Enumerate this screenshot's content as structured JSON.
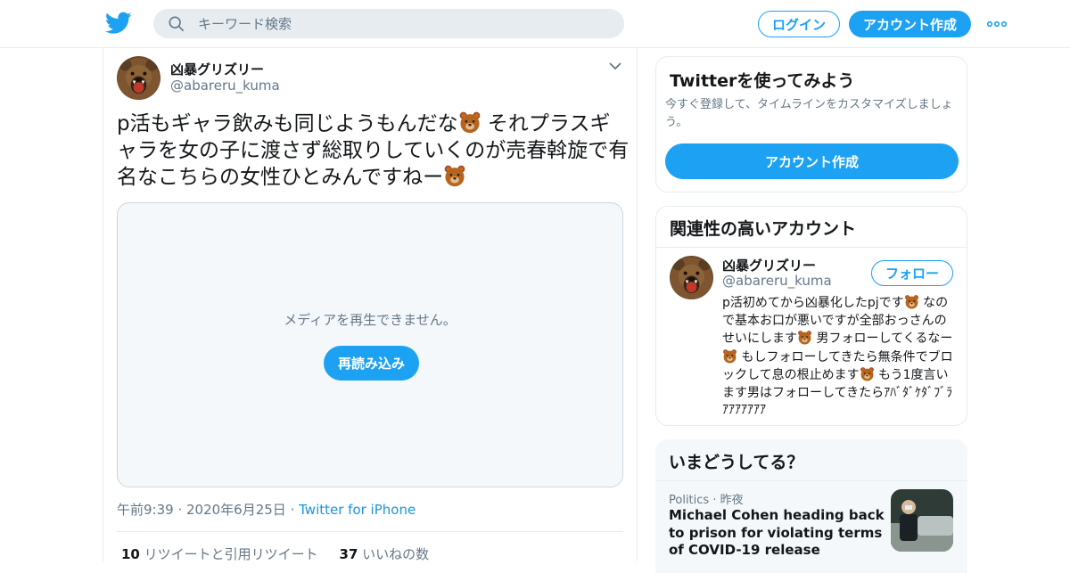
{
  "header": {
    "search_placeholder": "キーワード検索",
    "login_label": "ログイン",
    "signup_label": "アカウント作成"
  },
  "tweet": {
    "display_name": "凶暴グリズリー",
    "handle": "@abareru_kuma",
    "text_part1": "p活もギャラ飲みも同じようもんだな",
    "text_part2": " それプラスギャラを女の子に渡さず総取りしていくのが売春斡旋で有名なこちらの女性ひとみんですねー",
    "media_message": "メディアを再生できません。",
    "reload_label": "再読み込み",
    "time": "午前9:39",
    "date": "2020年6月25日",
    "source": "Twitter for iPhone",
    "retweets_count": "10",
    "retweets_label": "リツイートと引用リツイート",
    "likes_count": "37",
    "likes_label": "いいねの数"
  },
  "signup_card": {
    "title": "Twitterを使ってみよう",
    "description": "今すぐ登録して、タイムラインをカスタマイズしましょう。",
    "button_label": "アカウント作成"
  },
  "related": {
    "title": "関連性の高いアカウント",
    "display_name": "凶暴グリズリー",
    "handle": "@abareru_kuma",
    "follow_label": "フォロー",
    "bio_1": "p活初めてから凶暴化したpjです",
    "bio_2": " なので基本お口が悪いですが全部おっさんのせいにします",
    "bio_3": " 男フォローしてくるなー",
    "bio_4": " もしフォローしてきたら無条件でブロックして息の根止めます",
    "bio_5": " もう1度言います男はフォローしてきたらｱﾊﾞﾀﾞｹﾀﾞﾌﾞﾗｱｱｱｱｱｱｱ"
  },
  "trends": {
    "title": "いまどうしてる？",
    "category": "Politics",
    "time": "昨夜",
    "headline": "Michael Cohen heading back to prison for violating terms of COVID-19 release"
  },
  "colors": {
    "accent": "#1da1f2",
    "muted_text": "#657786",
    "border": "#e6ecf0"
  }
}
